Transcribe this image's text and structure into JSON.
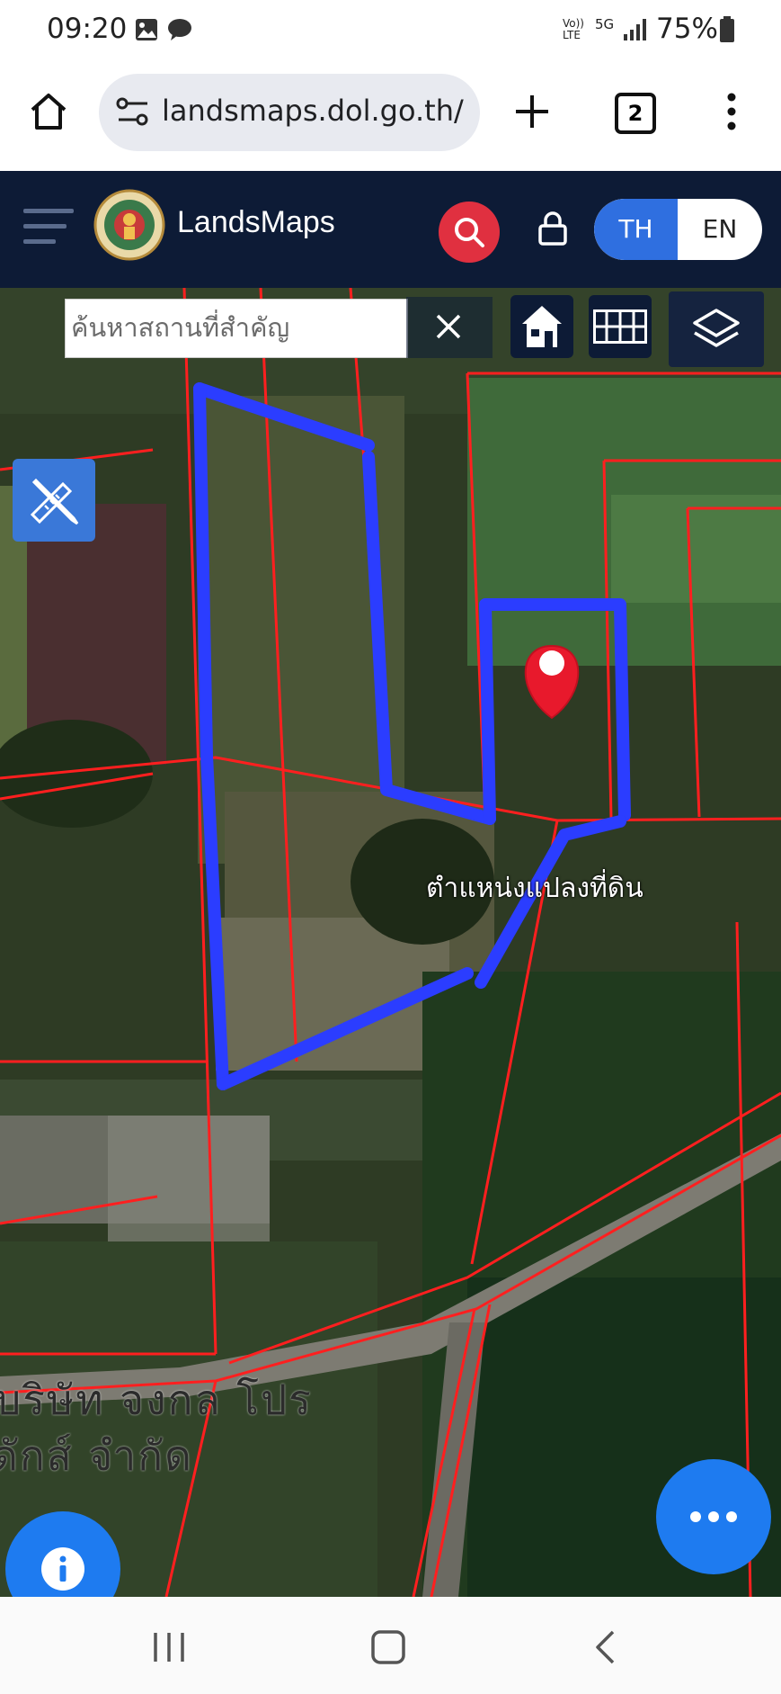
{
  "status_bar": {
    "time": "09:20",
    "network_label": "Vo)) LTE",
    "network_type": "5G",
    "battery": "75%"
  },
  "browser": {
    "url": "landsmaps.dol.go.th/",
    "tab_count": "2"
  },
  "app": {
    "name": "LandsMaps",
    "lang_th": "TH",
    "lang_en": "EN",
    "header_bg": "#0d1b36",
    "accent_blue": "#2f6fe0",
    "search_red": "#e03040"
  },
  "map": {
    "search_placeholder": "ค้นหาสถานที่สำคัญ",
    "pin_label": "ตำแหน่งแปลงที่ดิน",
    "company_label_line1": "บริษัท จงกล โปร",
    "company_label_line2": "ดักส์ จำกัด",
    "parcel_line_color": "#ff1f1f",
    "drawn_outline_color": "#2b3dff",
    "pin_color": "#e8192c"
  },
  "icons": {
    "home": "home-icon",
    "settings": "settings-sliders-icon",
    "new_tab": "plus-icon",
    "menu": "more-vertical-icon",
    "hamburger": "hamburger-icon",
    "search": "search-icon",
    "lock": "lock-icon",
    "clear": "close-icon",
    "map_home": "house-icon",
    "grid": "grid-icon",
    "layers": "layers-icon",
    "measure": "ruler-pencil-icon",
    "info": "info-icon",
    "more": "more-horizontal-icon",
    "nav_recent": "recent-apps-icon",
    "nav_home": "nav-home-icon",
    "nav_back": "back-icon"
  }
}
